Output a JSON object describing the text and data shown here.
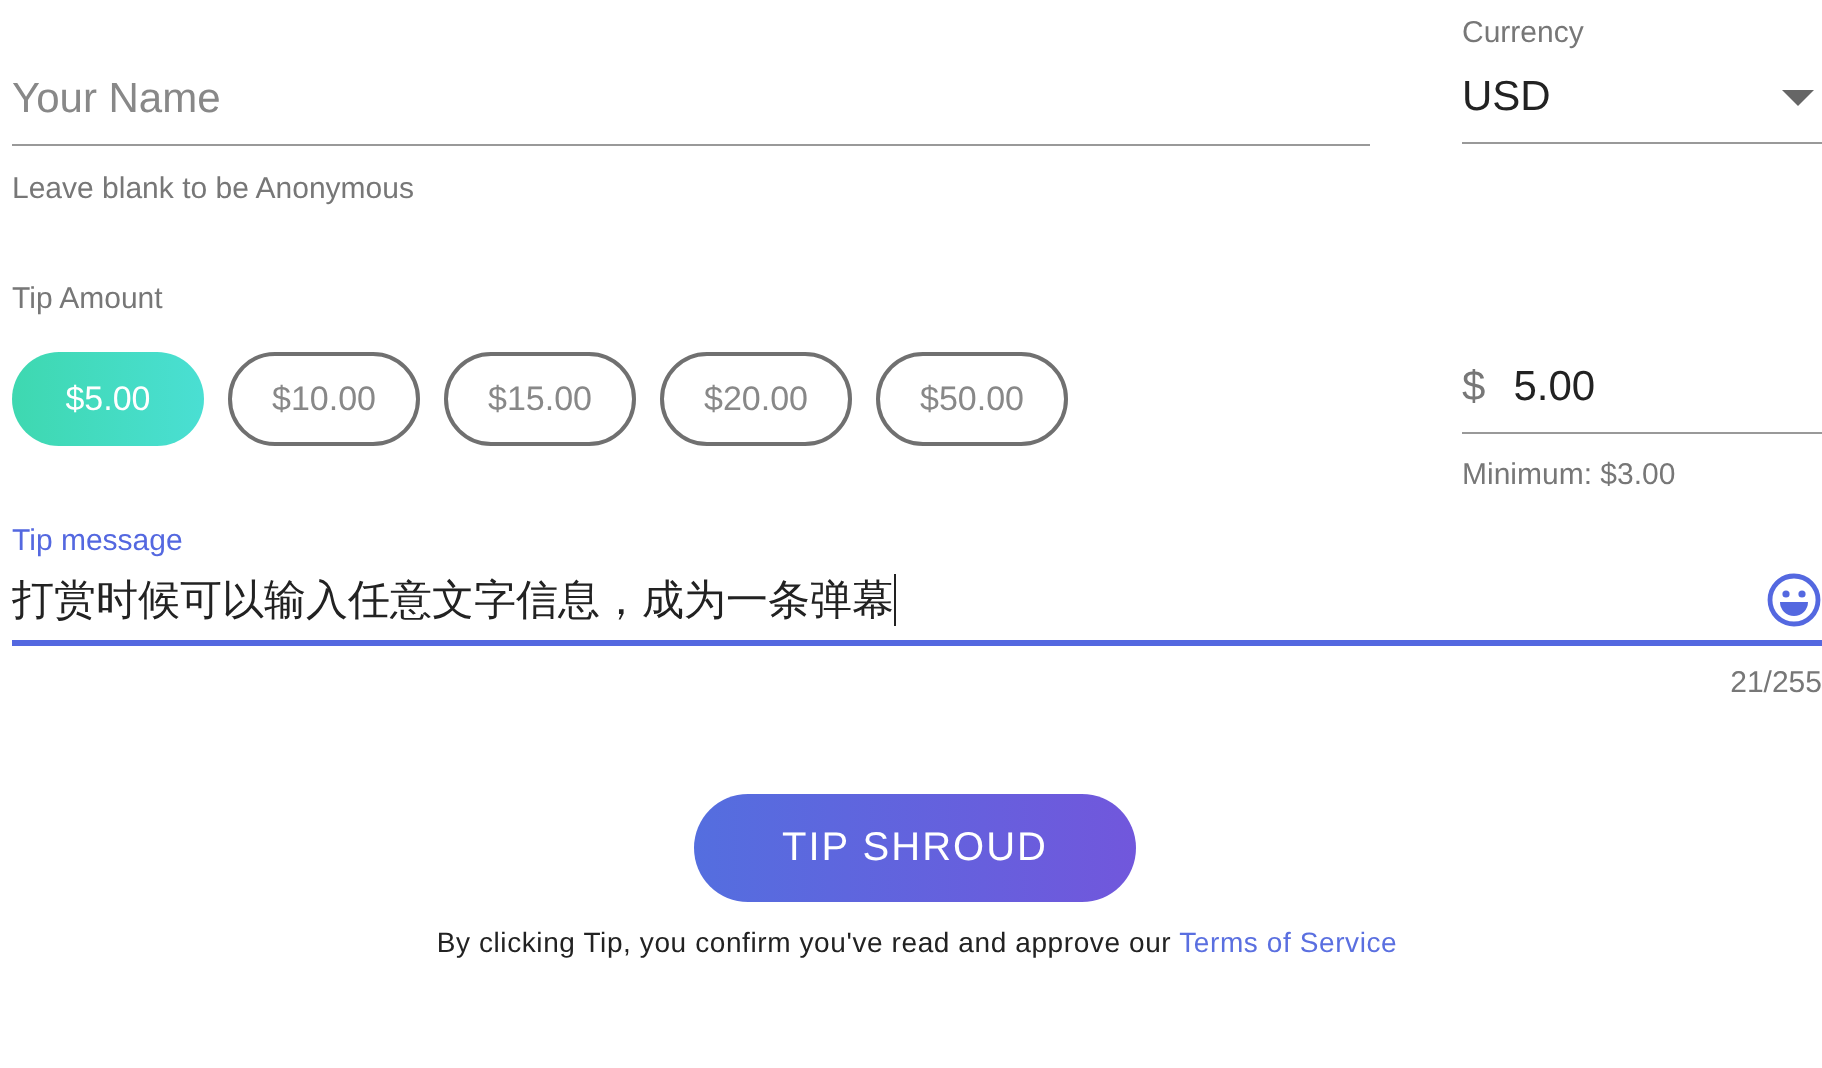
{
  "name_field": {
    "placeholder": "Your Name",
    "hint": "Leave blank to be Anonymous"
  },
  "currency": {
    "label": "Currency",
    "value": "USD"
  },
  "tip_amount": {
    "label": "Tip Amount",
    "presets": [
      {
        "label": "$5.00",
        "selected": true
      },
      {
        "label": "$10.00",
        "selected": false
      },
      {
        "label": "$15.00",
        "selected": false
      },
      {
        "label": "$20.00",
        "selected": false
      },
      {
        "label": "$50.00",
        "selected": false
      }
    ],
    "currency_symbol": "$",
    "value": "5.00",
    "minimum": "Minimum: $3.00"
  },
  "message": {
    "label": "Tip message",
    "value": "打赏时候可以输入任意文字信息，成为一条弹幕",
    "counter": "21/255",
    "focused": true
  },
  "submit": {
    "label": "TIP SHROUD"
  },
  "disclaimer": {
    "text": "By clicking Tip, you confirm you've read and approve our",
    "link": "Terms of Service"
  }
}
